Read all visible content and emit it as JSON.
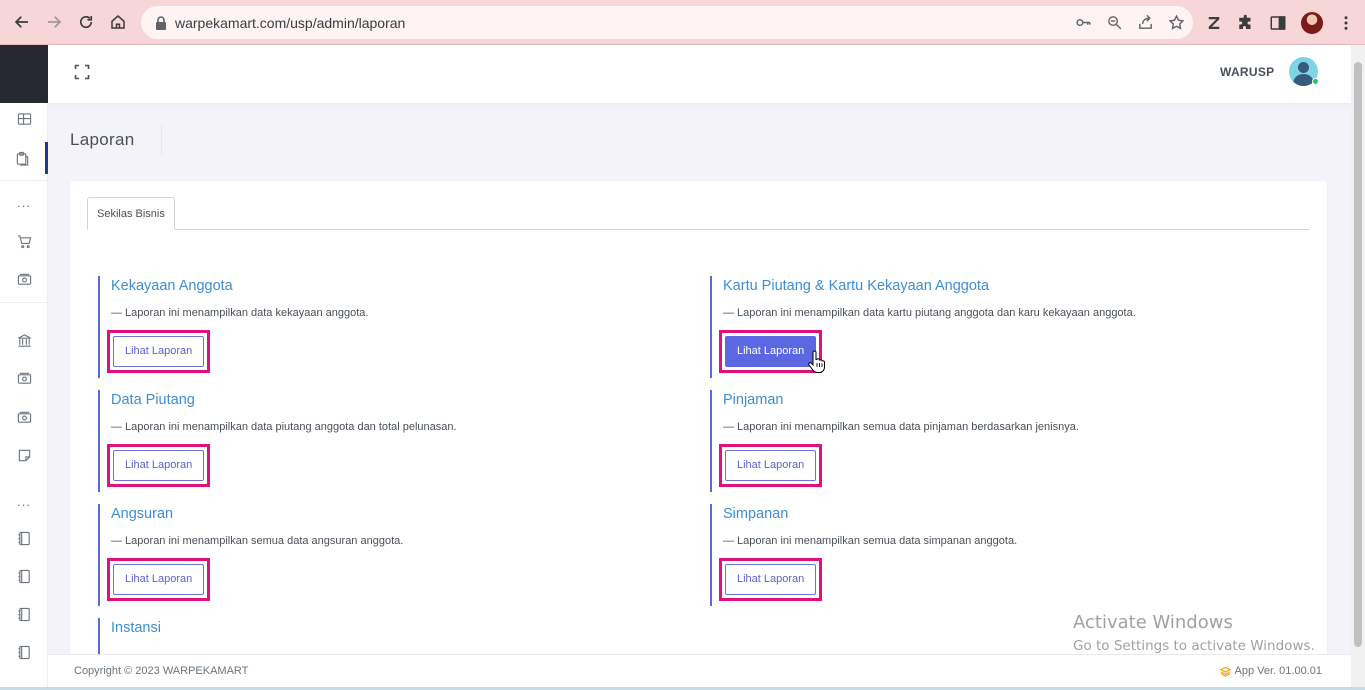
{
  "browser": {
    "url": "warpekamart.com/usp/admin/laporan"
  },
  "header": {
    "user_name": "WARUSP"
  },
  "sidebar": {
    "items": [
      "grid-icon",
      "clipboard-icon",
      "cart-icon",
      "money-icon",
      "bank-icon",
      "money-icon",
      "money-icon",
      "note-icon",
      "book-icon",
      "book-icon",
      "book-icon",
      "book-icon"
    ],
    "dots": "..."
  },
  "page": {
    "title": "Laporan",
    "tab": "Sekilas Bisnis"
  },
  "reports": [
    {
      "title": "Kekayaan Anggota",
      "desc": "— Laporan ini menampilkan data kekayaan anggota.",
      "button": "Lihat Laporan"
    },
    {
      "title": "Kartu Piutang & Kartu Kekayaan Anggota",
      "desc": "— Laporan ini menampilkan data kartu piutang anggota dan karu kekayaan anggota.",
      "button": "Lihat Laporan"
    },
    {
      "title": "Data Piutang",
      "desc": "— Laporan ini menampilkan data piutang anggota dan total pelunasan.",
      "button": "Lihat Laporan"
    },
    {
      "title": "Pinjaman",
      "desc": "— Laporan ini menampilkan semua data pinjaman berdasarkan jenisnya.",
      "button": "Lihat Laporan"
    },
    {
      "title": "Angsuran",
      "desc": "— Laporan ini menampilkan semua data angsuran anggota.",
      "button": "Lihat Laporan"
    },
    {
      "title": "Simpanan",
      "desc": "— Laporan ini menampilkan semua data simpanan anggota.",
      "button": "Lihat Laporan"
    },
    {
      "title": "Instansi"
    }
  ],
  "footer": {
    "copyright": "Copyright © 2023 WARPEKAMART",
    "version": "App Ver. 01.00.01"
  },
  "watermark": {
    "line1": "Activate Windows",
    "line2": "Go to Settings to activate Windows."
  },
  "colors": {
    "accent": "#5c68e2",
    "highlight": "#e0117a",
    "link": "#3d8fd1"
  }
}
